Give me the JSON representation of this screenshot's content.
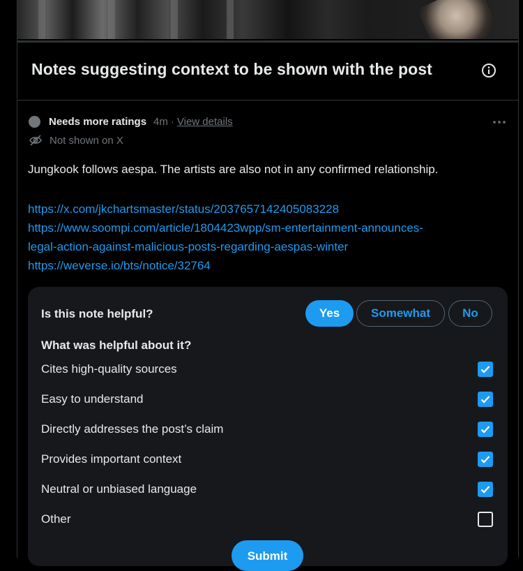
{
  "section": {
    "title": "Notes suggesting context to be shown with the post",
    "info_icon": "info-circle-icon"
  },
  "note": {
    "status": "Needs more ratings",
    "time": "4m",
    "separator": "·",
    "view_details": "View details",
    "visibility": "Not shown on X",
    "more_icon": "more-horizontal-icon",
    "text": "Jungkook follows aespa. The artists are also not in any confirmed relationship.",
    "links": [
      "https://x.com/jkchartsmaster/status/2037657142405083228",
      "https://www.soompi.com/article/1804423wpp/sm-entertainment-announces-",
      "legal-action-against-malicious-posts-regarding-aespas-winter",
      "https://weverse.io/bts/notice/32764"
    ]
  },
  "rating": {
    "question": "Is this note helpful?",
    "choices": [
      "Yes",
      "Somewhat",
      "No"
    ],
    "selected_choice": "Yes",
    "sub_question": "What was helpful about it?",
    "options": [
      {
        "label": "Cites high-quality sources",
        "checked": true
      },
      {
        "label": "Easy to understand",
        "checked": true
      },
      {
        "label": "Directly addresses the post’s claim",
        "checked": true
      },
      {
        "label": "Provides important context",
        "checked": true
      },
      {
        "label": "Neutral or unbiased language",
        "checked": true
      },
      {
        "label": "Other",
        "checked": false
      }
    ],
    "submit_label": "Submit"
  },
  "colors": {
    "accent": "#1d9bf0",
    "background": "#000000",
    "panel": "#16181c",
    "muted": "#71767b"
  }
}
